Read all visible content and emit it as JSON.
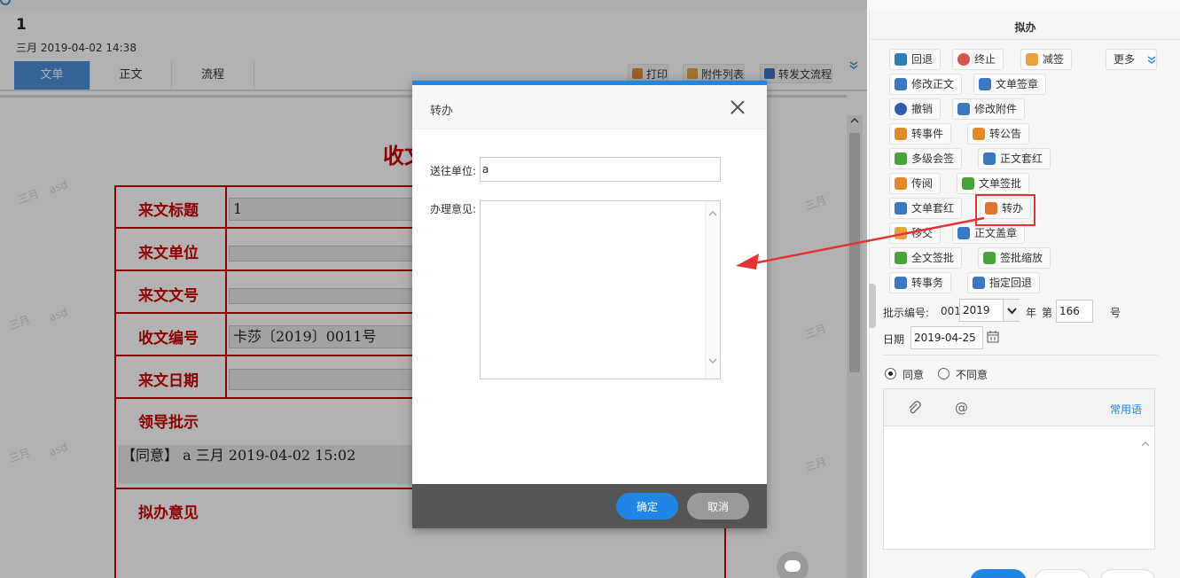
{
  "document": {
    "number": "1",
    "meta": "三月 2019-04-02 14:38",
    "tabs": [
      "文单",
      "正文",
      "流程"
    ],
    "toolbar": {
      "print": "打印",
      "attachments": "附件列表",
      "forward_flow": "转发文流程",
      "more_icon": "double-chevron-down-icon"
    },
    "title_fragment": "收文",
    "form": {
      "rows": [
        {
          "label": "来文标题",
          "value": "1"
        },
        {
          "label": "来文单位",
          "value": ""
        },
        {
          "label": "来文文号",
          "value": ""
        },
        {
          "label": "收文编号",
          "value": "卡莎〔2019〕0011号"
        },
        {
          "label": "来文日期",
          "value": ""
        }
      ],
      "leader_label": "领导批示",
      "leader_comment": "【同意】 a 三月 2019-04-02 15:02",
      "proposal_label": "拟办意见"
    },
    "watermark": [
      "三月",
      "asd",
      "三月",
      "asd",
      "三月",
      "asd",
      "三月",
      "三月",
      "三月"
    ]
  },
  "modal": {
    "title": "转办",
    "send_to_label": "送往单位:",
    "send_to_value": "a",
    "opinion_label": "办理意见:",
    "opinion_value": "",
    "ok": "确定",
    "cancel": "取消"
  },
  "panel": {
    "title": "拟办",
    "more": "更多",
    "actions": [
      "回退",
      "终止",
      "减签",
      "修改正文",
      "文单签章",
      "撤销",
      "修改附件",
      "转事件",
      "转公告",
      "多级会签",
      "正文套红",
      "传阅",
      "文单签批",
      "文单套红",
      "转办",
      "移交",
      "正文盖章",
      "全文签批",
      "签批缩放",
      "转事务",
      "指定回退"
    ],
    "approval_no_label": "批示编号:",
    "approval_prefix": "001",
    "year": "2019",
    "year_unit": "年",
    "seq_prefix": "第",
    "seq": "166",
    "seq_unit": "号",
    "date_label": "日期",
    "date": "2019-04-25",
    "agree": "同意",
    "disagree": "不同意",
    "common_phrases": "常用语",
    "highlight_color": "#e53333",
    "accent_color": "#1f86e6"
  }
}
